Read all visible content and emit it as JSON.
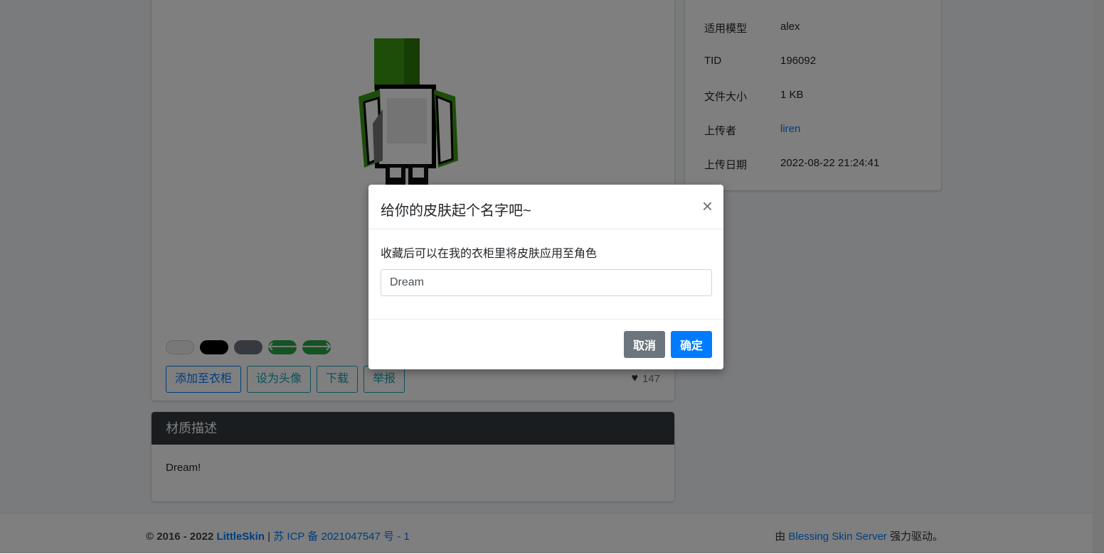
{
  "preview": {
    "actions": {
      "add_to_closet": "添加至衣柜",
      "set_avatar": "设为头像",
      "download": "下载",
      "report": "举报"
    },
    "likes": "147"
  },
  "description": {
    "header": "材质描述",
    "body": "Dream!"
  },
  "info": {
    "model_label": "适用模型",
    "model_value": "alex",
    "tid_label": "TID",
    "tid_value": "196092",
    "size_label": "文件大小",
    "size_value": "1 KB",
    "uploader_label": "上传者",
    "uploader_value": "liren",
    "date_label": "上传日期",
    "date_value": "2022-08-22 21:24:41"
  },
  "footer": {
    "copyright": "© 2016 - 2022",
    "site": "LittleSkin",
    "icp": "苏 ICP 备 2021047547 号 - 1",
    "powered_prefix": "由",
    "powered_link": "Blessing Skin Server",
    "powered_suffix": "强力驱动。"
  },
  "modal": {
    "title": "给你的皮肤起个名字吧~",
    "close_symbol": "×",
    "text": "收藏后可以在我的衣柜里将皮肤应用至角色",
    "input_value": "Dream",
    "cancel": "取消",
    "confirm": "确定"
  },
  "colors": {
    "primary": "#007bff",
    "secondary": "#6c757d",
    "success": "#28a745",
    "dark": "#343a40"
  }
}
